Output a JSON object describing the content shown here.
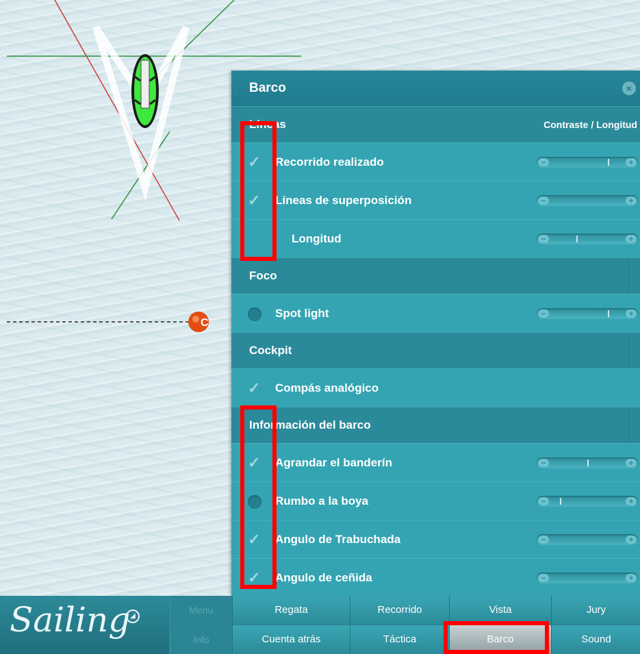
{
  "panel": {
    "title": "Barco",
    "close_icon": "close-icon",
    "sections": {
      "lineas": {
        "label": "Líneas",
        "right_label": "Contraste / Longitud"
      },
      "foco": {
        "label": "Foco"
      },
      "cockpit": {
        "label": "Cockpit"
      },
      "info": {
        "label": "Información del barco"
      }
    },
    "rows": {
      "recorrido": {
        "label": "Recorrido realizado",
        "checked": true
      },
      "superposicion": {
        "label": "Líneas de superposición",
        "checked": true
      },
      "longitud": {
        "label": "Longitud"
      },
      "spotlight": {
        "label": "Spot light",
        "checked": false
      },
      "compas": {
        "label": "Compás analógico",
        "checked": true
      },
      "banderin": {
        "label": "Agrandar el banderín",
        "checked": true
      },
      "rumbo": {
        "label": "Rumbo a la boya",
        "checked": false
      },
      "trabuchada": {
        "label": "Angulo de Trabuchada",
        "checked": true
      },
      "cenida": {
        "label": "Angulo de ceñida",
        "checked": true
      }
    },
    "check_glyph": "✓",
    "minus_glyph": "−",
    "plus_glyph": "+"
  },
  "map": {
    "boat_icon": "boat-icon",
    "buoy_icon": "buoy-icon",
    "buoy_label": "C"
  },
  "bottom": {
    "logo": "Sailing",
    "side": {
      "menu": "Menú",
      "info": "Info"
    },
    "nav_top": [
      "Regata",
      "Recorrido",
      "Vista",
      "Jury"
    ],
    "nav_bottom": [
      "Cuenta atrás",
      "Táctica",
      "Barco",
      "Sound"
    ],
    "active": "Barco"
  },
  "colors": {
    "panel": "#2d98a6",
    "section": "#2b8a9a",
    "highlight": "#ff0000",
    "water": "#dcebef"
  }
}
